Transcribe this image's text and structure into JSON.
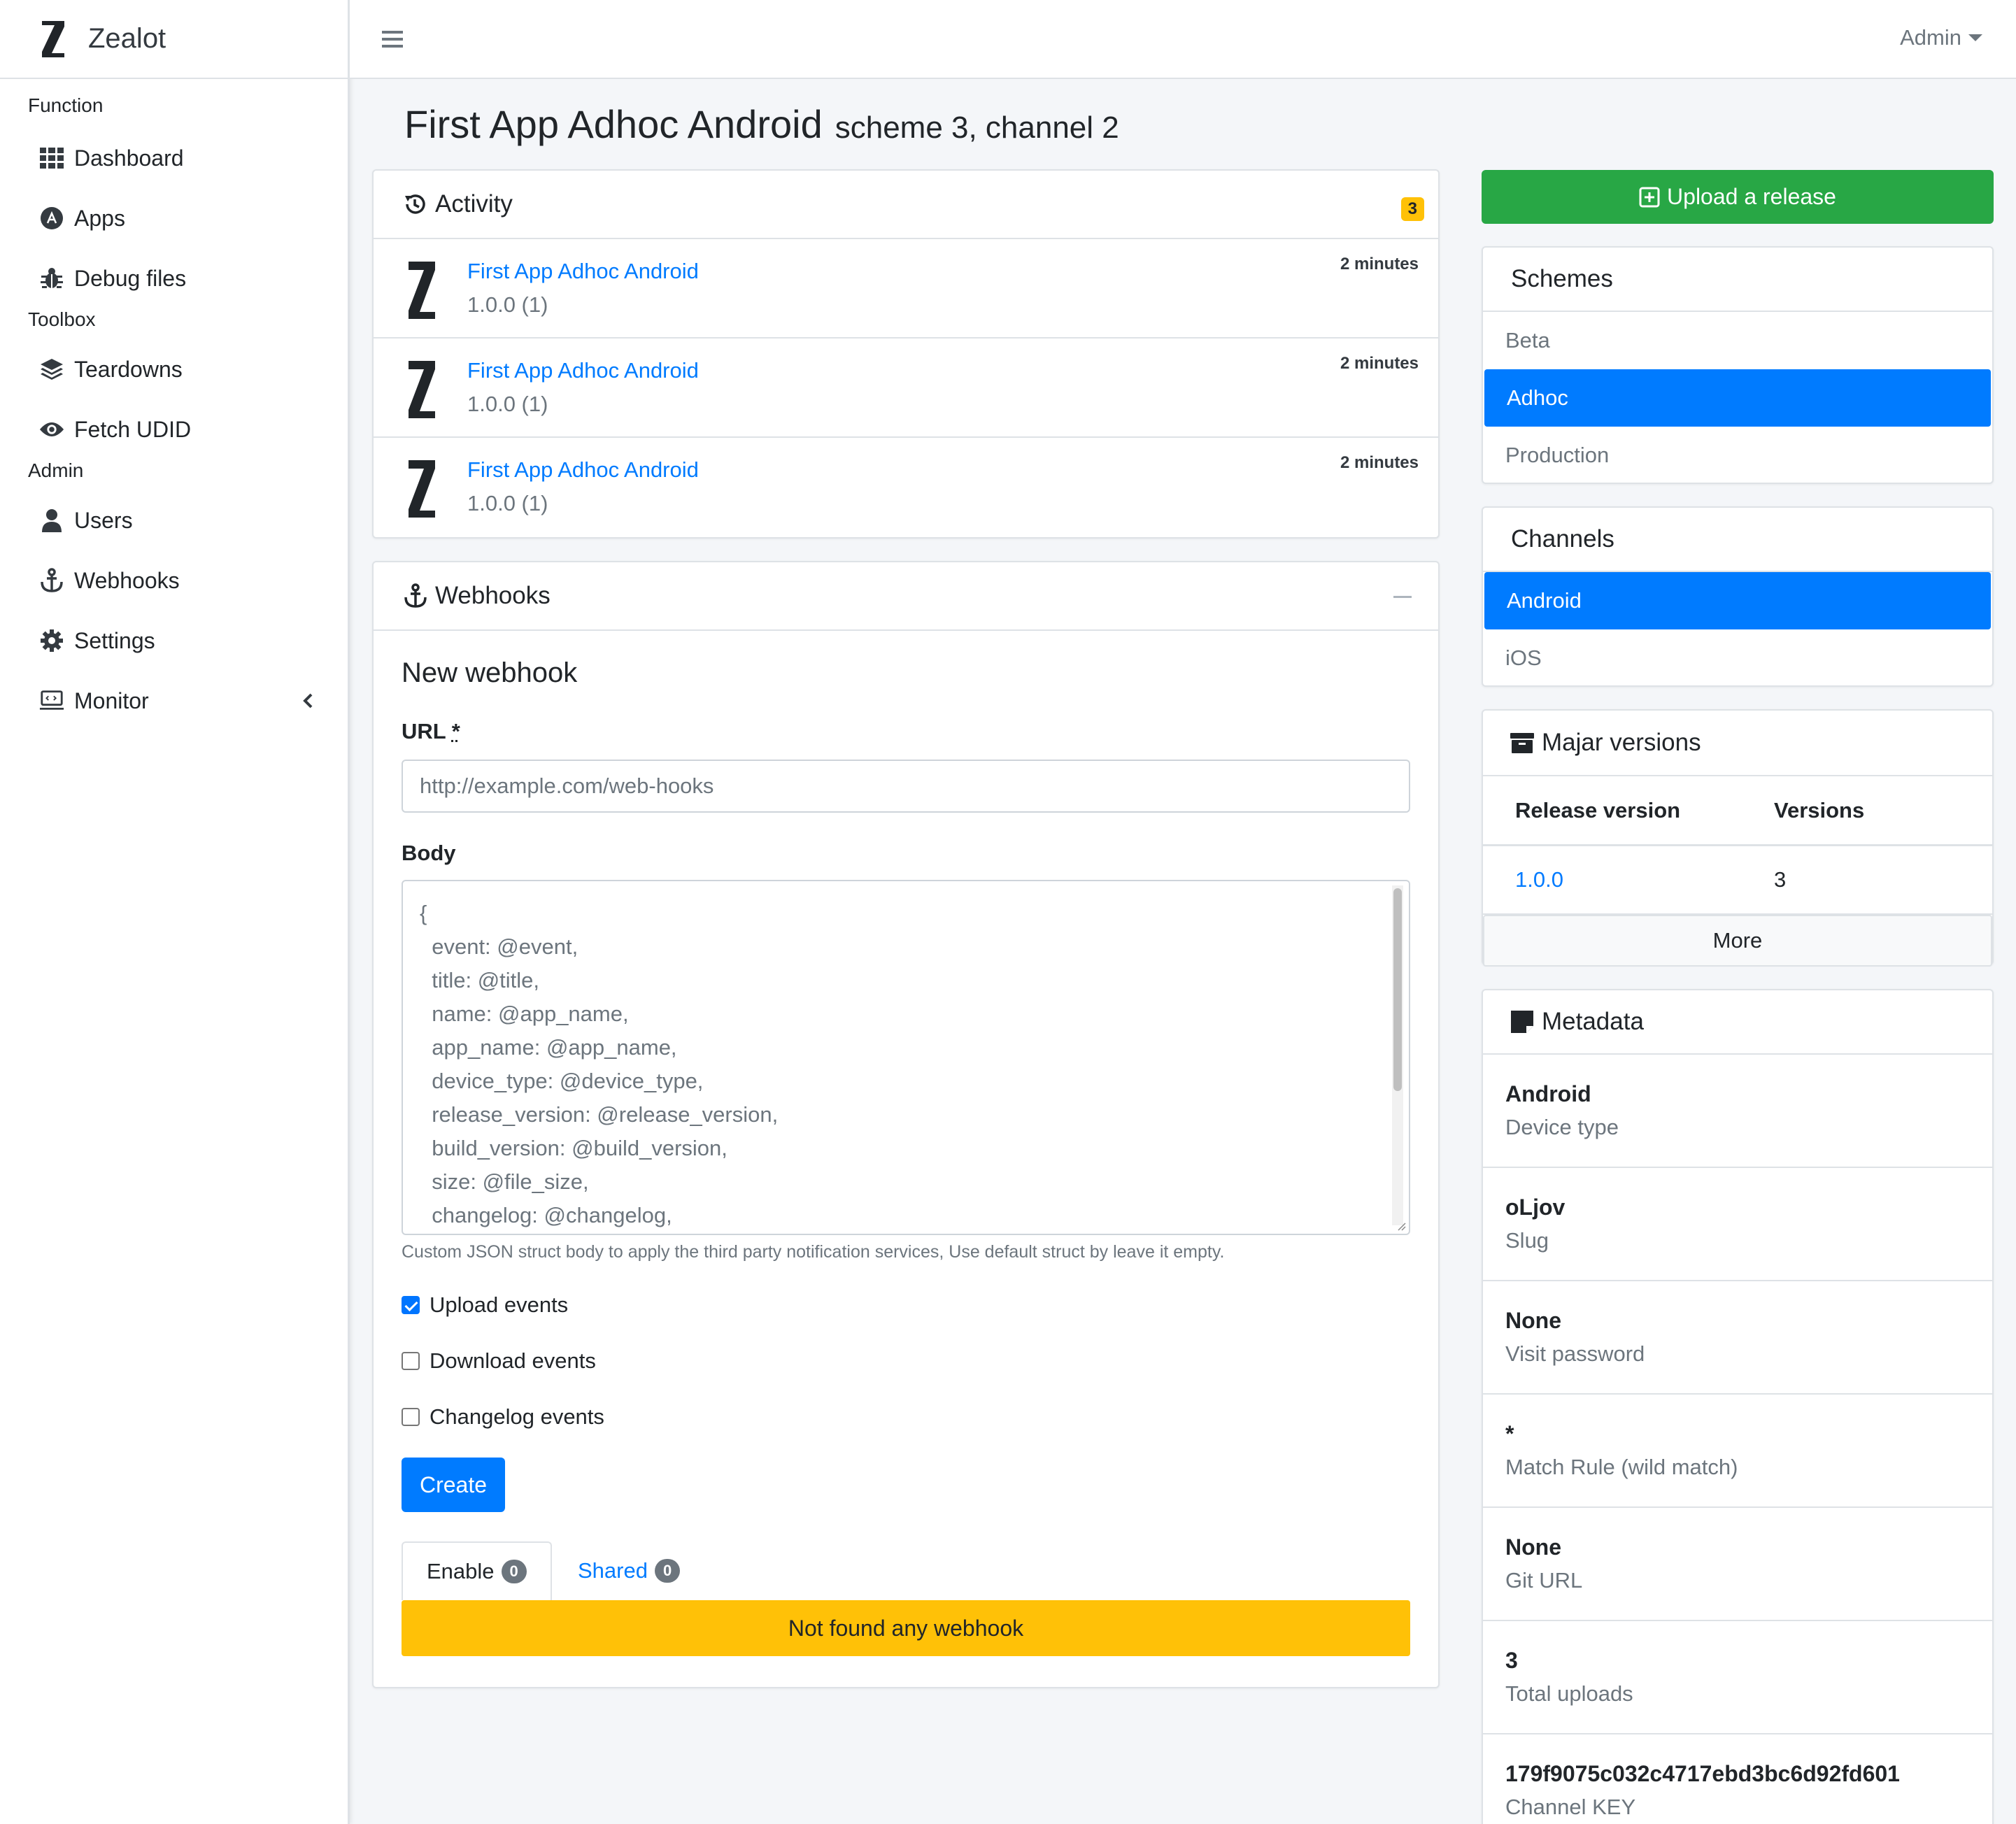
{
  "brand": {
    "name": "Zealot"
  },
  "sidebar": {
    "sections": [
      {
        "header": "Function",
        "items": [
          {
            "label": "Dashboard",
            "icon": "dashboard-grid-icon"
          },
          {
            "label": "Apps",
            "icon": "apps-icon"
          },
          {
            "label": "Debug files",
            "icon": "bug-icon"
          }
        ]
      },
      {
        "header": "Toolbox",
        "items": [
          {
            "label": "Teardowns",
            "icon": "layers-icon"
          },
          {
            "label": "Fetch UDID",
            "icon": "eye-icon"
          }
        ]
      },
      {
        "header": "Admin",
        "items": [
          {
            "label": "Users",
            "icon": "user-icon"
          },
          {
            "label": "Webhooks",
            "icon": "anchor-icon"
          },
          {
            "label": "Settings",
            "icon": "gear-icon"
          },
          {
            "label": "Monitor",
            "icon": "monitor-icon"
          }
        ]
      }
    ]
  },
  "topbar": {
    "user_menu": "Admin"
  },
  "page": {
    "title": "First App Adhoc Android",
    "subtitle": "scheme 3, channel 2"
  },
  "activity": {
    "title": "Activity",
    "count": "3",
    "items": [
      {
        "title": "First App Adhoc Android",
        "version": "1.0.0 (1)",
        "time": "2 minutes"
      },
      {
        "title": "First App Adhoc Android",
        "version": "1.0.0 (1)",
        "time": "2 minutes"
      },
      {
        "title": "First App Adhoc Android",
        "version": "1.0.0 (1)",
        "time": "2 minutes"
      }
    ]
  },
  "webhooks": {
    "title": "Webhooks",
    "form_title": "New webhook",
    "url_label": "URL",
    "url_required": "*",
    "url_placeholder": "http://example.com/web-hooks",
    "body_label": "Body",
    "body_lines": [
      "{",
      "  event: @event,",
      "  title: @title,",
      "  name: @app_name,",
      "  app_name: @app_name,",
      "  device_type: @device_type,",
      "  release_version: @release_version,",
      "  build_version: @build_version,",
      "  size: @file_size,",
      "  changelog: @changelog,"
    ],
    "body_help": "Custom JSON struct body to apply the third party notification services, Use default struct by leave it empty.",
    "checkboxes": [
      {
        "label": "Upload events",
        "checked": true
      },
      {
        "label": "Download events",
        "checked": false
      },
      {
        "label": "Changelog events",
        "checked": false
      }
    ],
    "create_label": "Create",
    "tabs": [
      {
        "label": "Enable",
        "count": "0",
        "active": true
      },
      {
        "label": "Shared",
        "count": "0",
        "active": false
      }
    ],
    "empty_message": "Not found any webhook"
  },
  "upload_button": "Upload a release",
  "schemes": {
    "title": "Schemes",
    "items": [
      {
        "label": "Beta",
        "active": false
      },
      {
        "label": "Adhoc",
        "active": true
      },
      {
        "label": "Production",
        "active": false
      }
    ]
  },
  "channels": {
    "title": "Channels",
    "items": [
      {
        "label": "Android",
        "active": true
      },
      {
        "label": "iOS",
        "active": false
      }
    ]
  },
  "versions": {
    "title": "Majar versions",
    "headers": [
      "Release version",
      "Versions"
    ],
    "rows": [
      {
        "release": "1.0.0",
        "count": "3"
      }
    ],
    "more_label": "More"
  },
  "metadata": {
    "title": "Metadata",
    "items": [
      {
        "value": "Android",
        "key": "Device type"
      },
      {
        "value": "oLjov",
        "key": "Slug"
      },
      {
        "value": "None",
        "key": "Visit password"
      },
      {
        "value": "*",
        "key": "Match Rule (wild match)"
      },
      {
        "value": "None",
        "key": "Git URL"
      },
      {
        "value": "3",
        "key": "Total uploads"
      },
      {
        "value": "179f9075c032c4717ebd3bc6d92fd601",
        "key": "Channel KEY"
      }
    ]
  },
  "colors": {
    "primary": "#007bff",
    "success": "#28a745",
    "warning": "#ffc107"
  }
}
